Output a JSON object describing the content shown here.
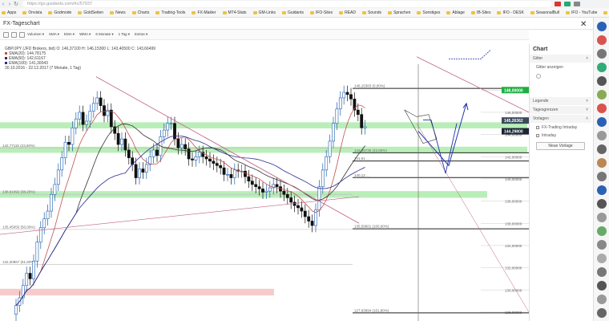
{
  "browser": {
    "url": "https://go.guidants.com/#c/57937",
    "bookmarks": [
      "Apps",
      "Onvista",
      "Godmode",
      "GoldSeiten",
      "News",
      "Charts",
      "Trading-Tools",
      "FX-Makler",
      "MT4-Stats",
      "GM-Links",
      "Guidants",
      "IFO-Sites",
      "READ",
      "Sounds",
      "Sprachen",
      "Sonstiges",
      "Ablage",
      "IB-Sites",
      "IFO - DESK",
      "SeasonalBull",
      "IFO - YouTube",
      "Live - YouTube"
    ]
  },
  "app": {
    "title": "FX-Tageschart",
    "toolbar": [
      "Volumen",
      "SMA",
      "EMA",
      "WMA",
      "6 Monate",
      "1 Tag",
      "Extras"
    ]
  },
  "chart_data": {
    "type": "candlestick",
    "symbol_line": "GBP/JPY (JFD Brokers, bid)  O: 146,37100  H: 146,15300  L: 143,40500  C: 143,66499",
    "indicators": [
      {
        "label": "SMA(20): 144,78175",
        "color": "#c0504d"
      },
      {
        "label": "EMA(50): 142,61167",
        "color": "#333333"
      },
      {
        "label": "EMA(100): 141,30043",
        "color": "#2b2b8f"
      }
    ],
    "info_line": "30.10.2016 - 22.12.2017  (7 Monate, 1 Tag)",
    "ylim": [
      127.2,
      152.5
    ],
    "y_ticks": [
      {
        "value": 148,
        "label": "148,00000"
      },
      {
        "value": 146,
        "label": "146,00000"
      },
      {
        "value": 144,
        "label": "144,00000"
      },
      {
        "value": 142,
        "label": "142,00000"
      },
      {
        "value": 140,
        "label": "140,00000"
      },
      {
        "value": 138,
        "label": "138,00000"
      },
      {
        "value": 136,
        "label": "136,00000"
      },
      {
        "value": 134,
        "label": "134,00000"
      },
      {
        "value": 132,
        "label": "132,00000"
      },
      {
        "value": 130,
        "label": "130,00000"
      },
      {
        "value": 128,
        "label": "128,00000"
      }
    ],
    "price_tags": [
      {
        "value": 148.0,
        "label": "148,00000",
        "color": "#1fae3f"
      },
      {
        "value": 145.26,
        "label": "145,26362",
        "color": "#3a4a5c"
      },
      {
        "value": 144.29,
        "label": "144,29800",
        "color": "#1b2533"
      }
    ],
    "fib_levels": [
      {
        "value": 148.15,
        "label": "148,15383 (0,00%)"
      },
      {
        "value": 142.35,
        "label": "142,35735 (23,60%)"
      },
      {
        "value": 141.61,
        "label": "141,61 ..."
      },
      {
        "value": 140.12,
        "label": "140,12 ..."
      },
      {
        "value": 135.5,
        "label": "135,59601 (100,00%)"
      },
      {
        "value": 127.93,
        "label": "127,93994 (161,80%)"
      }
    ],
    "left_levels": [
      {
        "value": 142.77,
        "label": "142,77115 (23,60%)"
      },
      {
        "value": 138.61,
        "label": "138,61092 (38,20%)"
      },
      {
        "value": 135.45,
        "label": "135,45055 (50,00%)"
      },
      {
        "value": 132.31,
        "label": "132,30867 (61,80%)"
      }
    ],
    "zones": [
      {
        "from": 144.55,
        "to": 145.1,
        "color": "#7fe07f"
      },
      {
        "from": 142.35,
        "to": 142.9,
        "color": "#7fe07f"
      },
      {
        "from": 138.3,
        "to": 138.9,
        "color": "#7fe07f"
      },
      {
        "from": 129.5,
        "to": 130.1,
        "color": "#f0a0a0"
      }
    ],
    "close": [
      128.6,
      129.3,
      130.4,
      131.5,
      131.0,
      132.6,
      134.3,
      135.6,
      136.4,
      137.1,
      138.6,
      139.5,
      140.8,
      141.9,
      143.3,
      143.1,
      144.6,
      145.4,
      146.0,
      144.9,
      145.2,
      146.1,
      146.8,
      147.3,
      146.6,
      145.7,
      146.2,
      144.7,
      144.1,
      143.1,
      143.6,
      142.6,
      141.9,
      141.3,
      140.1,
      140.9,
      140.6,
      141.3,
      142.0,
      142.6,
      142.1,
      143.8,
      144.4,
      145.0,
      145.0,
      143.6,
      142.8,
      143.1,
      142.7,
      141.8,
      141.7,
      142.0,
      142.4,
      142.0,
      141.8,
      141.6,
      141.4,
      141.2,
      141.0,
      140.4,
      140.4,
      140.1,
      140.8,
      140.7,
      140.7,
      140.2,
      139.8,
      139.5,
      139.3,
      139.1,
      138.8,
      138.9,
      139.2,
      139.5,
      139.3,
      138.9,
      138.6,
      138.3,
      137.9,
      137.6,
      137.4,
      137.1,
      136.6,
      136.2,
      135.8,
      137.2,
      139.3,
      140.8,
      142.0,
      143.4,
      145.0,
      146.3,
      147.3,
      147.8,
      147.6,
      147.2,
      146.2,
      145.8,
      144.6,
      144.7
    ]
  },
  "panel": {
    "title": "Chart",
    "filter_label": "Gitter",
    "filter_option": "Gitter anzeigen",
    "sections": [
      "Legende",
      "Tagesgrenzen",
      "Vorlagen"
    ],
    "templates": [
      "FX-Trading Intraday",
      "Intraday"
    ],
    "new_template_button": "Neue Vorlage"
  }
}
